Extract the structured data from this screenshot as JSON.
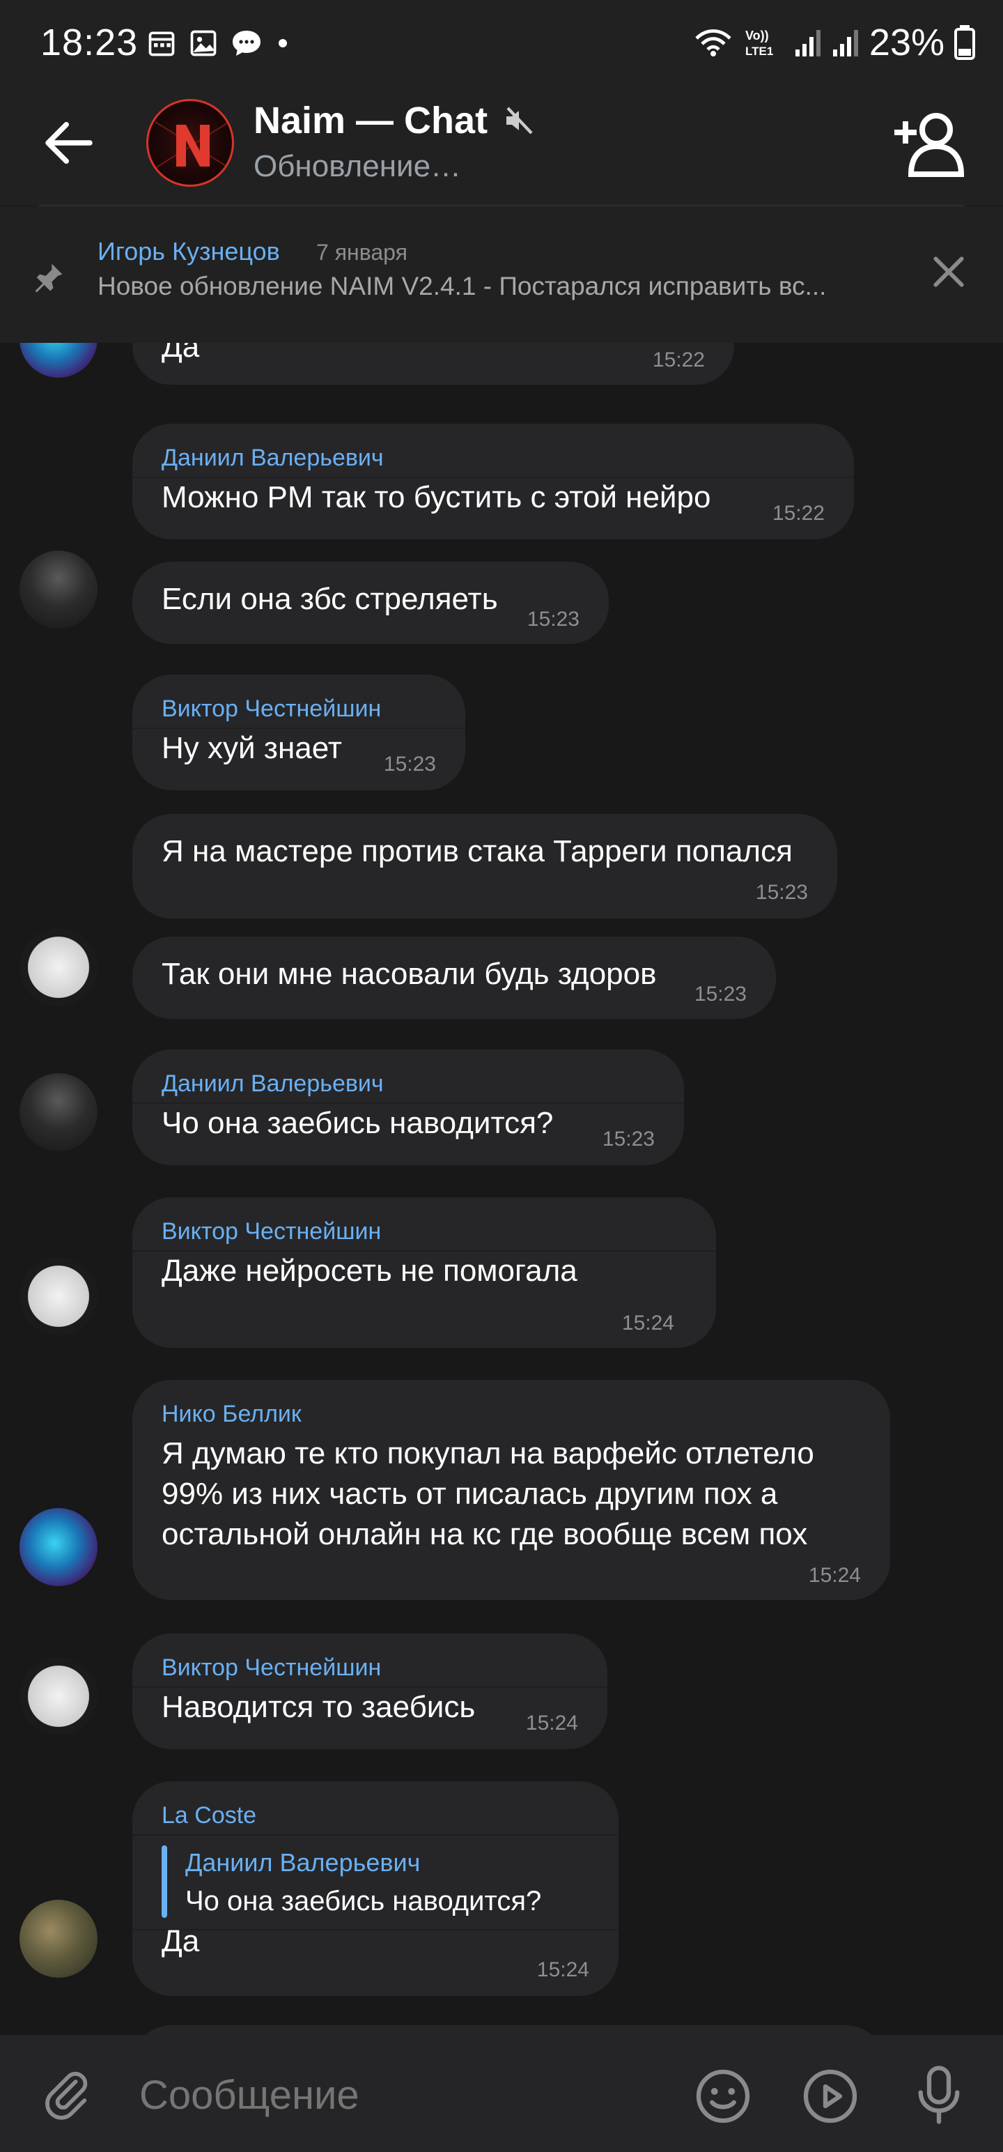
{
  "status_bar": {
    "time": "18:23",
    "battery": "23%",
    "left_icons": [
      "calendar-icon",
      "image-icon",
      "chat-icon",
      "dot-icon"
    ],
    "right_icons": [
      "wifi-icon",
      "volte-icon",
      "signal-icon",
      "signal-icon",
      "battery-icon"
    ]
  },
  "header": {
    "title": "Naim — Chat",
    "subtitle": "Обновление…",
    "avatar_letter": "N"
  },
  "pinned": {
    "author": "Игорь Кузнецов",
    "date": "7 января",
    "text": "Новое обновление NAIM V2.4.1 - Постарался исправить вс..."
  },
  "messages": [
    {
      "author": "",
      "text": [
        "Да"
      ],
      "time": "15:22",
      "avatar": "av-smoke"
    },
    {
      "author": "Даниил Валерьевич",
      "text": [
        "Можно PM так то бустить с этой нейро"
      ],
      "time": "15:22",
      "avatar": ""
    },
    {
      "author": "",
      "text": [
        "Если она збс стреляеть"
      ],
      "time": "15:23",
      "avatar": "av-hood"
    },
    {
      "author": "Виктор Честнейшин",
      "text": [
        "Ну хуй знает"
      ],
      "time": "15:23",
      "avatar": ""
    },
    {
      "author": "",
      "text": [
        "Я на мастере против стака Тарреги попался"
      ],
      "time": "15:23",
      "avatar": ""
    },
    {
      "author": "",
      "text": [
        "Так они мне насовали будь здоров"
      ],
      "time": "15:23",
      "avatar": "av-panda"
    },
    {
      "author": "Даниил Валерьевич",
      "text": [
        "Чо она заебись наводится?"
      ],
      "time": "15:23",
      "avatar": "av-hood"
    },
    {
      "author": "Виктор Честнейшин",
      "text": [
        "Даже нейросеть не помогала"
      ],
      "time": "15:24",
      "avatar": "av-panda"
    },
    {
      "author": "Нико Беллик",
      "text": [
        "Я думаю те кто покупал на варфейс отлетело",
        "99% из них часть от писалась другим пох а",
        "остальной онлайн на кс где вообще всем пох"
      ],
      "time": "15:24",
      "avatar": "av-smoke"
    },
    {
      "author": "Виктор Честнейшин",
      "text": [
        "Наводится то заебись"
      ],
      "time": "15:24",
      "avatar": "av-panda"
    },
    {
      "author": "La Coste",
      "reply_author": "Даниил Валерьевич",
      "reply_text": "Чо она заебись наводится?",
      "text": [
        "Да"
      ],
      "time": "15:24",
      "avatar": "av-photo"
    }
  ],
  "input": {
    "placeholder": "Сообщение"
  }
}
